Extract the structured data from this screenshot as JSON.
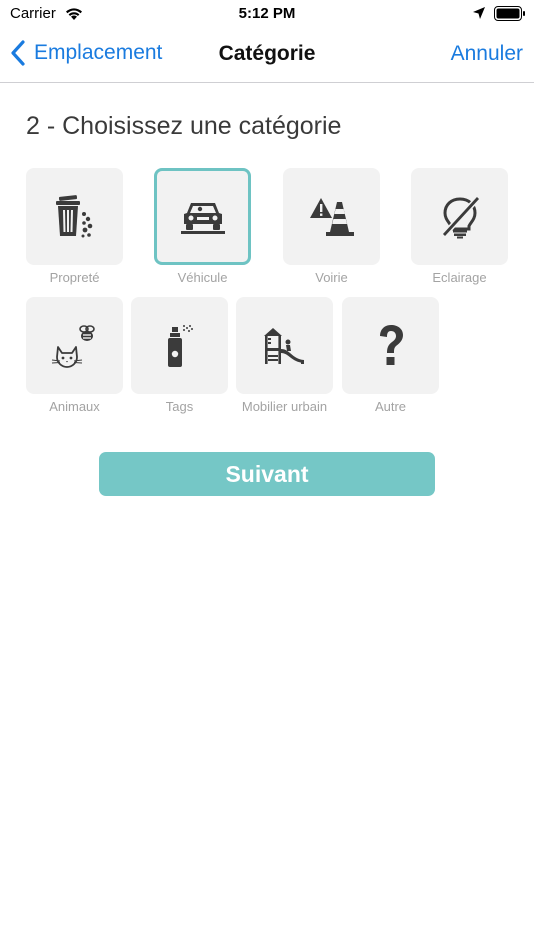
{
  "status_bar": {
    "carrier": "Carrier",
    "time": "5:12 PM",
    "icons": [
      "wifi-icon",
      "location-arrow-icon",
      "battery-icon"
    ]
  },
  "nav_bar": {
    "back_label": "Emplacement",
    "title": "Catégorie",
    "cancel_label": "Annuler",
    "tint_color": "#1a7bdf"
  },
  "step_heading": "2 - Choisissez une catégorie",
  "categories": [
    {
      "label": "Propreté",
      "icon": "trash-can-icon",
      "selected": false
    },
    {
      "label": "Véhicule",
      "icon": "car-icon",
      "selected": true
    },
    {
      "label": "Voirie",
      "icon": "road-works-icon",
      "selected": false
    },
    {
      "label": "Eclairage",
      "icon": "broken-bulb-icon",
      "selected": false
    },
    {
      "label": "Animaux",
      "icon": "cat-and-bee-icon",
      "selected": false
    },
    {
      "label": "Tags",
      "icon": "spray-can-icon",
      "selected": false
    },
    {
      "label": "Mobilier urbain",
      "icon": "playground-icon",
      "selected": false
    },
    {
      "label": "Autre",
      "icon": "question-mark-icon",
      "selected": false
    }
  ],
  "next_button": {
    "label": "Suivant",
    "color": "#75c7c6"
  },
  "colors": {
    "selected_border": "#6ec3c3",
    "tile_background": "#f2f2f2",
    "label_gray": "#a3a3a3",
    "icon_dark": "#3b3b3b"
  }
}
